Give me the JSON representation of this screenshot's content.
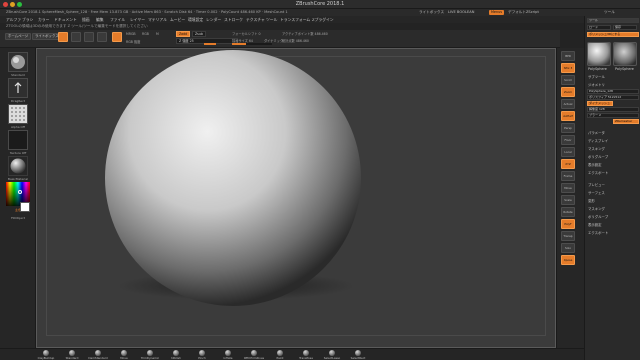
{
  "window": {
    "title": "ZBrushCore 2018.1"
  },
  "info": {
    "left": "ZBrushCore 2018.1  SphereMesh_Sphere_128  ·  Free Mem 13.873 GB  ·  Active Mem 863  ·  Scratch Disk 64  ·  Timer 0.002  ·  PolyCount 486.460 KP  ·  MeshCount 1",
    "menu_items": [
      "ライトボックス",
      "LIVE BOOLEAN",
      "デフォルトZScript",
      "ツール"
    ],
    "orange_tag": "Menus"
  },
  "menubar": {
    "items": [
      "アルファ",
      "ブラシ",
      "カラー",
      "ドキュメント",
      "描画",
      "編集",
      "ファイル",
      "レイヤー",
      "マテリアル",
      "ムービー",
      "環境設定",
      "レンダー",
      "ストローク",
      "テクスチャ",
      "ツール",
      "トランスフォーム",
      "Zプラグイン"
    ]
  },
  "hint": {
    "text": "ZTOOLの領域は3Dのみ使用できます  Z ツール/ツールで編集モードを選択してください"
  },
  "toolbar": {
    "buttons": [
      "ホームページ",
      "ライトボックス"
    ],
    "icons": [
      "edit",
      "draw",
      "move",
      "scale",
      "rotate"
    ],
    "mode_labels": [
      "ZADD",
      "ZSUB"
    ],
    "mrgb": "MRGB",
    "rgb_label": "RGB",
    "m_label": "M",
    "rgb_intensity_label": "RGB 強度",
    "zadd_label": "Zadd",
    "zsub_label": "Zsub",
    "z_intensity": "Z 強度 25",
    "focal_label": "フォーカルシフト 0",
    "draw_size_label": "描画サイズ 64",
    "dynamic_label": "ダイナミック",
    "active_points": "アクティブポイント数 486.460",
    "total_points": "総計点数 486.460"
  },
  "left_shelf": {
    "tiles": [
      "Standard",
      "DragRect",
      "Alpha Off",
      "Texture Off",
      "BasicMaterial",
      "ColorPicker"
    ],
    "color_label": "主色",
    "secondary_label": "FillObject"
  },
  "right_shelf": {
    "buttons": [
      "BPR",
      "SPix 3",
      "Scroll",
      "Zoom",
      "Actual",
      "AAHalf",
      "Persp",
      "Floor",
      "Local",
      "XYZ",
      "Frame",
      "Move",
      "Scale",
      "Rotate",
      "PolyF",
      "Transp",
      "Solo",
      "Xpose"
    ]
  },
  "tray": {
    "header": "ツール",
    "load_button": "ロード",
    "save_button": "保存",
    "items": [
      "ポリメッシュ3Dにする",
      "サブツール",
      "ジオメトリ",
      "パラメータ",
      "ディスプレイ",
      "マスキング",
      "ポリグループ",
      "表示設定",
      "エクスポート"
    ],
    "thumb_labels": [
      "PolySphere",
      "PolySphere"
    ],
    "bars": [
      "PolySphere_128",
      "ポリスフィア 512x512",
      "ダイナメッシュ",
      "解像度 128",
      "ブラー 2",
      "ZRemesher"
    ],
    "menu_lower": [
      "プレビュー",
      "サーフェス",
      "変形",
      "マスキング",
      "ポリグループ",
      "表示設定",
      "エクスポート"
    ]
  },
  "bottom_shelf": {
    "brushes": [
      "ClayBuildup",
      "Standard",
      "DamStandard",
      "Move",
      "TrimDynamic",
      "hPolish",
      "Pinch",
      "Inflate",
      "IMM Primitives",
      "Paint",
      "TransPose",
      "SelectLasso",
      "SelectRect"
    ]
  },
  "colors": {
    "accent": "#e57c2a",
    "canvas_bg": "#3b3b3b",
    "panel_bg": "#262626"
  }
}
